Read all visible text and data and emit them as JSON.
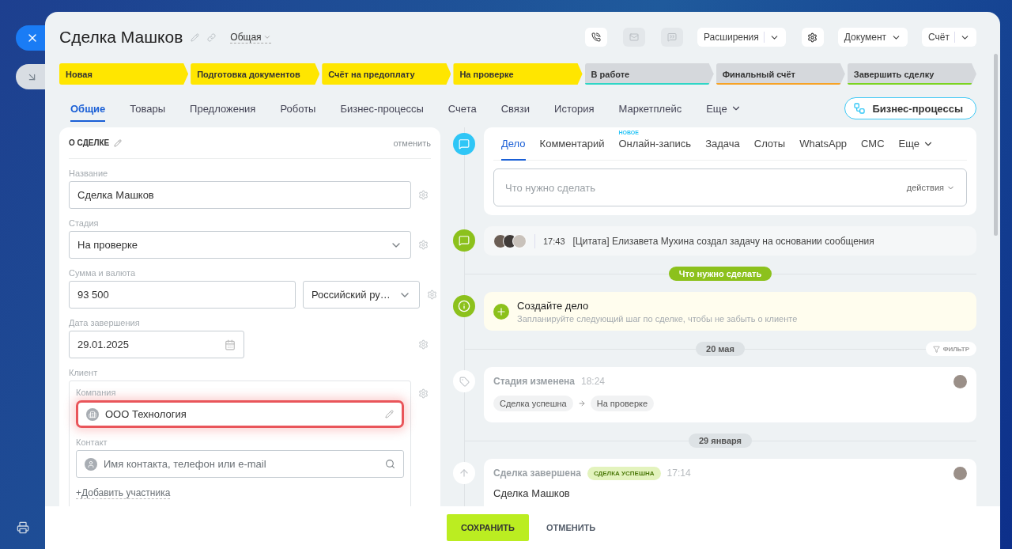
{
  "title": "Сделка Машков",
  "category": "Общая",
  "icon_buttons": [
    {
      "kind": "phone",
      "disabled": false
    },
    {
      "kind": "mail",
      "disabled": true
    },
    {
      "kind": "chat",
      "disabled": true
    }
  ],
  "extensions": "Расширения",
  "document": "Документ",
  "invoice": "Счёт",
  "stages": [
    {
      "label": "Новая",
      "reached": true,
      "color": "#ffe600"
    },
    {
      "label": "Подготовка документов",
      "reached": true,
      "color": "#ffe600"
    },
    {
      "label": "Счёт на предоплату",
      "reached": true,
      "color": "#ffe600"
    },
    {
      "label": "На проверке",
      "reached": true,
      "color": "#ffe600"
    },
    {
      "label": "В работе",
      "reached": false,
      "color": "#2fd6c6"
    },
    {
      "label": "Финальный счёт",
      "reached": false,
      "color": "#f7a325"
    },
    {
      "label": "Завершить сделку",
      "reached": false,
      "color": "#7bd421"
    }
  ],
  "tabs": [
    {
      "label": "Общие",
      "selected": true
    },
    {
      "label": "Товары",
      "selected": false
    },
    {
      "label": "Предложения",
      "selected": false
    },
    {
      "label": "Роботы",
      "selected": false
    },
    {
      "label": "Бизнес-процессы",
      "selected": false
    },
    {
      "label": "Счета",
      "selected": false
    },
    {
      "label": "Связи",
      "selected": false
    },
    {
      "label": "История",
      "selected": false
    },
    {
      "label": "Маркетплейс",
      "selected": false
    }
  ],
  "more_tab": "Еще",
  "bp_button": "Бизнес-процессы",
  "about": {
    "title": "О СДЕЛКЕ",
    "cancel": "отменить",
    "fields": [
      {
        "kind": "text",
        "label": "Название",
        "value": "Сделка Машков"
      },
      {
        "kind": "select",
        "label": "Стадия",
        "value": "На проверке"
      },
      {
        "kind": "money",
        "label": "Сумма и валюта",
        "value": "93 500",
        "currency": "Российский ру…"
      },
      {
        "kind": "date",
        "label": "Дата завершения",
        "value": "29.01.2025"
      }
    ],
    "client": {
      "label": "Клиент",
      "company_label": "Компания",
      "company": "ООО Технология",
      "company_highlighted": true,
      "contact_label": "Контакт",
      "contact_placeholder": "Имя контакта, телефон или e-mail",
      "add": "+Добавить участника"
    }
  },
  "composer": {
    "tabs": [
      {
        "label": "Дело",
        "selected": true
      },
      {
        "label": "Комментарий",
        "selected": false
      },
      {
        "label": "Онлайн-запись",
        "selected": false,
        "badge": "НОВОЕ"
      },
      {
        "label": "Задача",
        "selected": false
      },
      {
        "label": "Слоты",
        "selected": false
      },
      {
        "label": "WhatsApp",
        "selected": false
      },
      {
        "label": "СМС",
        "selected": false
      }
    ],
    "more": "Еще",
    "placeholder": "Что нужно сделать",
    "actions": "действия"
  },
  "timeline": [
    {
      "kind": "comment",
      "time": "17:43",
      "text": "[Цитата] Елизавета Мухина создал задачу на основании сообщения"
    },
    {
      "kind": "section",
      "label": "Что нужно сделать"
    },
    {
      "kind": "info",
      "title": "Создайте дело",
      "text": "Запланируйте следующий шаг по сделке, чтобы не забыть о клиенте"
    },
    {
      "kind": "date",
      "label": "20 мая",
      "filter": "ФИЛЬТР"
    },
    {
      "kind": "stage",
      "title": "Стадия изменена",
      "time": "18:24",
      "from": "Сделка успешна",
      "to": "На проверке"
    },
    {
      "kind": "date",
      "label": "29 января"
    },
    {
      "kind": "closed",
      "title": "Сделка завершена",
      "badge": "СДЕЛКА УСПЕШНА",
      "time": "17:14",
      "text": "Сделка Машков"
    }
  ],
  "footer": {
    "save": "СОХРАНИТЬ",
    "cancel": "ОТМЕНИТЬ"
  }
}
